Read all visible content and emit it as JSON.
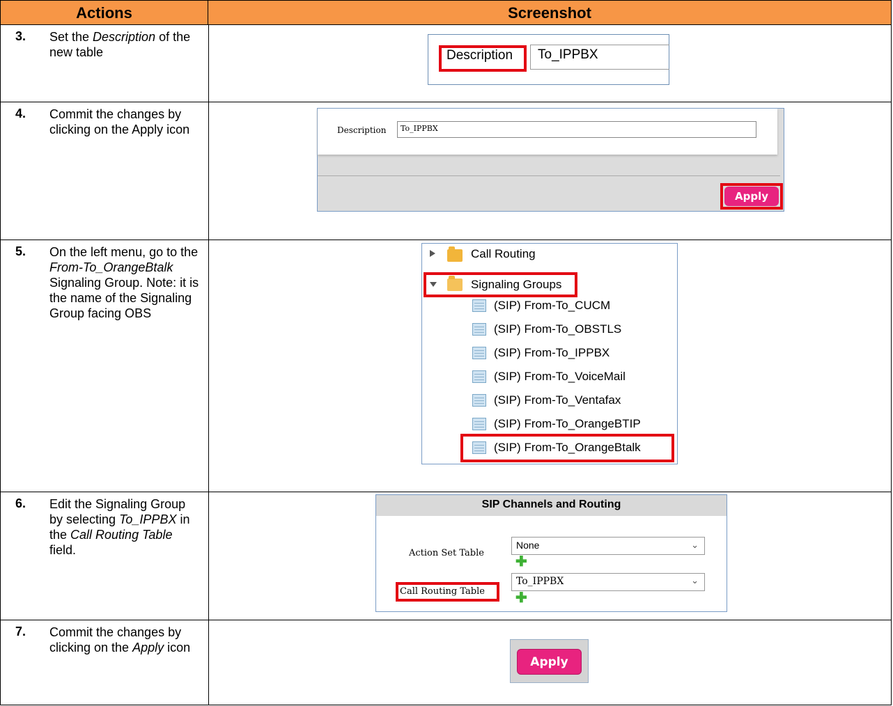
{
  "header": {
    "actions": "Actions",
    "screenshot": "Screenshot"
  },
  "colors": {
    "header_bg": "#f79646",
    "highlight": "#e30613",
    "apply_button": "#e8237f",
    "plus_icon": "#3fb135"
  },
  "steps": [
    {
      "num": "3.",
      "text_a": "Set the ",
      "text_b": "Description",
      "text_c": " of the new table",
      "shot": {
        "label": "Description",
        "value": "To_IPPBX"
      }
    },
    {
      "num": "4.",
      "text": "Commit the changes by clicking on the Apply icon",
      "shot": {
        "label": "Description",
        "value": "To_IPPBX",
        "button": "Apply"
      }
    },
    {
      "num": "5.",
      "text_a": "On the left menu, go to the ",
      "text_b": "From-To_OrangeBtalk",
      "text_c": " Signaling Group. Note: it is the name of the Signaling Group facing OBS",
      "shot": {
        "folders": [
          "Call Routing",
          "Signaling Groups"
        ],
        "items": [
          "(SIP) From-To_CUCM",
          "(SIP) From-To_OBSTLS",
          "(SIP) From-To_IPPBX",
          "(SIP) From-To_VoiceMail",
          "(SIP) From-To_Ventafax",
          "(SIP) From-To_OrangeBTIP",
          "(SIP) From-To_OrangeBtalk"
        ],
        "icons": [
          "collapsed-arrow-icon",
          "expanded-arrow-icon",
          "folder-icon",
          "table-icon"
        ]
      }
    },
    {
      "num": "6.",
      "text_a": "Edit the Signaling Group by selecting ",
      "text_b": "To_IPPBX",
      "text_c": " in the ",
      "text_d": "Call Routing Table",
      "text_e": " field.",
      "shot": {
        "title": "SIP Channels and Routing",
        "action_label": "Action Set Table",
        "action_value": "None",
        "routing_label": "Call Routing Table",
        "routing_value": "To_IPPBX"
      }
    },
    {
      "num": "7.",
      "text_a": "Commit the changes by clicking on the ",
      "text_b": "Apply",
      "text_c": " icon",
      "shot": {
        "button": "Apply"
      }
    }
  ]
}
